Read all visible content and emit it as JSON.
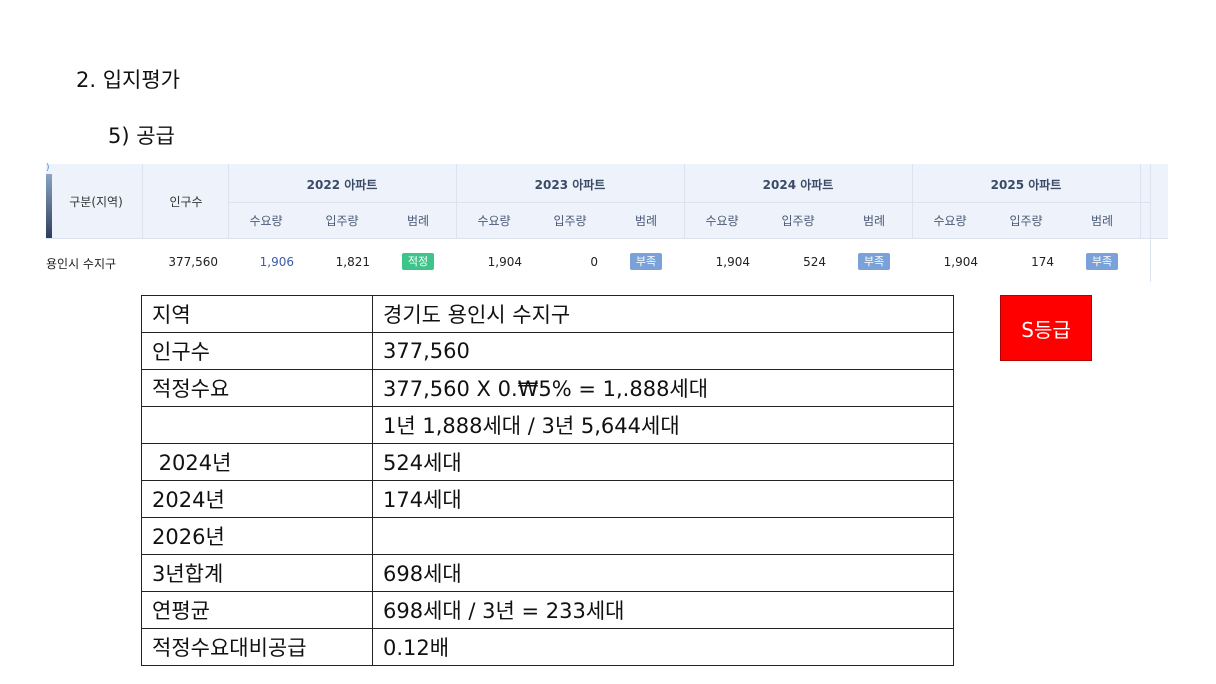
{
  "heading": "2. 입지평가",
  "subheading": "5) 공급",
  "summary": {
    "col_region": "구분(지역)",
    "col_population": "인구수",
    "years": [
      {
        "label": "2022 아파트",
        "demand": "1,906",
        "move_in": "1,821",
        "legend": "적정",
        "legend_status": "ok"
      },
      {
        "label": "2023 아파트",
        "demand": "1,904",
        "move_in": "0",
        "legend": "부족",
        "legend_status": "low"
      },
      {
        "label": "2024 아파트",
        "demand": "1,904",
        "move_in": "524",
        "legend": "부족",
        "legend_status": "low"
      },
      {
        "label": "2025 아파트",
        "demand": "1,904",
        "move_in": "174",
        "legend": "부족",
        "legend_status": "low"
      }
    ],
    "sub_demand": "수요량",
    "sub_move_in": "입주량",
    "sub_legend": "범례",
    "row_region": "용인시 수지구",
    "row_population": "377,560",
    "colors": {
      "header_bg": "#eef3fb",
      "badge_ok": "#3cc48a",
      "badge_low": "#7aa2d8"
    }
  },
  "detail_rows": [
    {
      "key": "지역",
      "value": "경기도 용인시 수지구"
    },
    {
      "key": "인구수",
      "value": "377,560"
    },
    {
      "key": "적정수요",
      "value": "377,560 X 0.₩5% = 1,.888세대"
    },
    {
      "key": "",
      "value": "1년 1,888세대 / 3년 5,644세대"
    },
    {
      "key": " 2024년",
      "value": "524세대"
    },
    {
      "key": "2024년",
      "value": "174세대"
    },
    {
      "key": "2026년",
      "value": ""
    },
    {
      "key": "3년합계",
      "value": "698세대"
    },
    {
      "key": "연평균",
      "value": "698세대 / 3년 = 233세대"
    },
    {
      "key": "적정수요대비공급",
      "value": "0.12배"
    }
  ],
  "grade": {
    "label": "S등급",
    "color": "#ff0000"
  }
}
